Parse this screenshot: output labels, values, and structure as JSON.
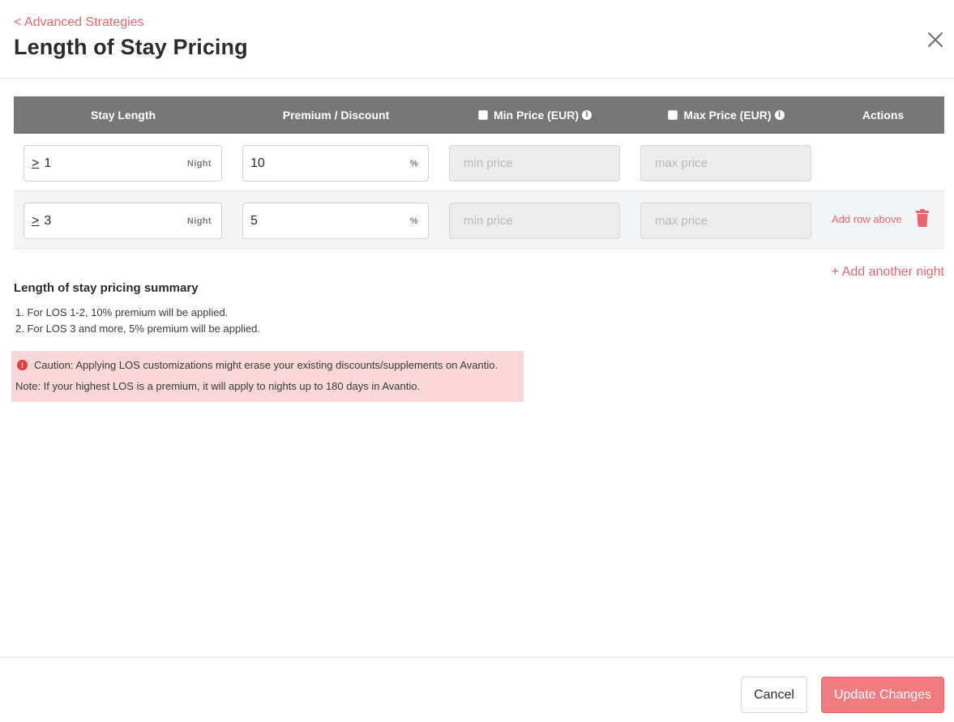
{
  "header": {
    "back_label": "< Advanced Strategies",
    "title": "Length of Stay Pricing",
    "close_icon": "close-icon"
  },
  "table": {
    "columns": {
      "stay_length": "Stay Length",
      "premium_discount": "Premium / Discount",
      "min_price": "Min Price (EUR)",
      "max_price": "Max Price (EUR)",
      "actions": "Actions"
    },
    "min_price_checked": false,
    "max_price_checked": false,
    "rows": [
      {
        "operator": ">",
        "stay_value": "1",
        "stay_unit": "Night",
        "premium_value": "10",
        "premium_unit": "%",
        "min_placeholder": "min price",
        "max_placeholder": "max price"
      },
      {
        "operator": ">",
        "stay_value": "3",
        "stay_unit": "Night",
        "premium_value": "5",
        "premium_unit": "%",
        "min_placeholder": "min price",
        "max_placeholder": "max price",
        "add_row_label": "Add row above"
      }
    ],
    "add_night_label": "+ Add another night"
  },
  "summary": {
    "title": "Length of stay pricing summary",
    "items": [
      "1. For LOS 1-2, 10% premium will be applied.",
      "2. For LOS 3 and more, 5% premium will be applied."
    ]
  },
  "caution": {
    "line1": "Caution: Applying LOS customizations might erase your existing discounts/supplements on Avantio.",
    "line2": "Note: If your highest LOS is a premium, it will apply to nights up to 180 days in Avantio."
  },
  "footer": {
    "cancel_label": "Cancel",
    "update_label": "Update Changes"
  },
  "colors": {
    "accent": "#e8676d",
    "header_bg": "#777777",
    "caution_bg": "#f9d7d8"
  }
}
